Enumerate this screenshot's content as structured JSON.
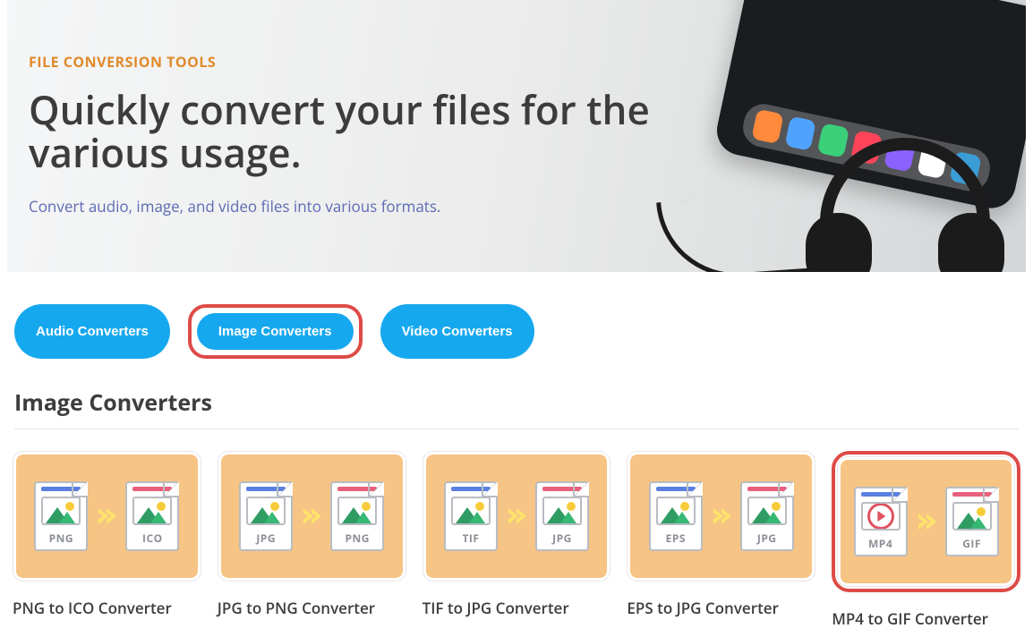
{
  "hero": {
    "eyebrow": "FILE CONVERSION TOOLS",
    "headline": "Quickly convert your files for the various usage.",
    "subhead": "Convert audio, image, and video files into various formats."
  },
  "tabs": [
    {
      "label": "Audio Converters",
      "selected": false,
      "highlighted": false
    },
    {
      "label": "Image Converters",
      "selected": true,
      "highlighted": true
    },
    {
      "label": "Video Converters",
      "selected": false,
      "highlighted": false
    }
  ],
  "section_title": "Image Converters",
  "converters": [
    {
      "from": "PNG",
      "to": "ICO",
      "title": "PNG to ICO Converter",
      "from_bar": "blue",
      "to_bar": "red",
      "from_kind": "image",
      "to_kind": "image",
      "highlighted": false
    },
    {
      "from": "JPG",
      "to": "PNG",
      "title": "JPG to PNG Converter",
      "from_bar": "blue",
      "to_bar": "red",
      "from_kind": "image",
      "to_kind": "image",
      "highlighted": false
    },
    {
      "from": "TIF",
      "to": "JPG",
      "title": "TIF to JPG Converter",
      "from_bar": "blue",
      "to_bar": "red",
      "from_kind": "image",
      "to_kind": "image",
      "highlighted": false
    },
    {
      "from": "EPS",
      "to": "JPG",
      "title": "EPS to JPG Converter",
      "from_bar": "blue",
      "to_bar": "red",
      "from_kind": "image",
      "to_kind": "image",
      "highlighted": false
    },
    {
      "from": "MP4",
      "to": "GIF",
      "title": "MP4 to GIF Converter",
      "from_bar": "blue",
      "to_bar": "red",
      "from_kind": "video",
      "to_kind": "image",
      "highlighted": true
    }
  ],
  "colors": {
    "accent_blue": "#16a8ef",
    "highlight_red": "#dd4b47",
    "card_peach": "#f6c484",
    "eyebrow_orange": "#e08a2b",
    "subhead_indigo": "#5e6bb3"
  }
}
